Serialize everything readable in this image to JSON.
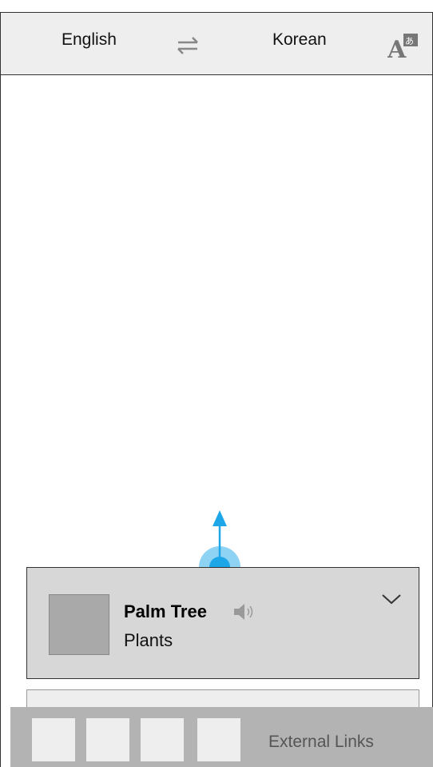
{
  "header": {
    "source_language": "English",
    "target_language": "Korean",
    "swap_icon": "swap-arrows-icon",
    "translate_icon": "translate-icon"
  },
  "result_card": {
    "title": "Palm Tree",
    "subtitle": "Plants",
    "speaker_icon": "speaker-icon",
    "expand_icon": "chevron-down-icon"
  },
  "bottom_bar": {
    "link_label": "External Links"
  },
  "colors": {
    "accent": "#1ea7e8",
    "card_bg": "#d7d7d7",
    "bar_bg": "#b3b3b3"
  }
}
